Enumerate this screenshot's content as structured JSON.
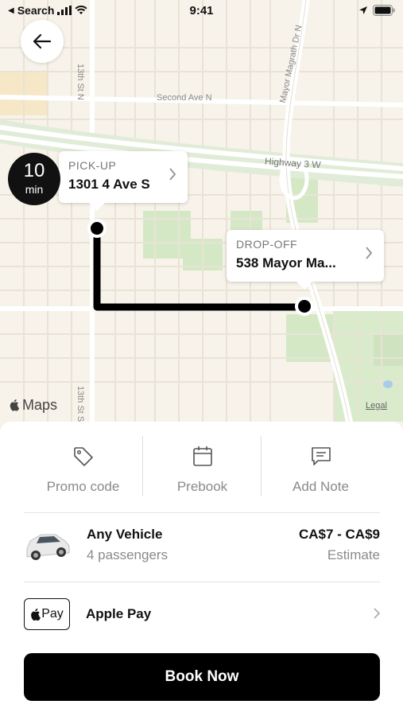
{
  "status_bar": {
    "back_app": "Search",
    "time": "9:41"
  },
  "map": {
    "streets": [
      "13th St N",
      "Second Ave N",
      "Mayor Magrath Dr N",
      "Highway 3 W",
      "13th St S"
    ],
    "brand": "Maps",
    "legal": "Legal",
    "eta": {
      "value": "10",
      "unit": "min"
    },
    "pickup": {
      "label": "PICK-UP",
      "address": "1301 4 Ave S"
    },
    "dropoff": {
      "label": "DROP-OFF",
      "address": "538 Mayor Ma..."
    }
  },
  "actions": [
    {
      "label": "Promo code",
      "icon": "tag-icon"
    },
    {
      "label": "Prebook",
      "icon": "calendar-icon"
    },
    {
      "label": "Add Note",
      "icon": "message-icon"
    }
  ],
  "vehicle": {
    "name": "Any Vehicle",
    "passengers": "4 passengers",
    "price": "CA$7 - CA$9",
    "price_note": "Estimate"
  },
  "payment": {
    "badge": "Pay",
    "method": "Apple Pay"
  },
  "book_button": "Book Now"
}
